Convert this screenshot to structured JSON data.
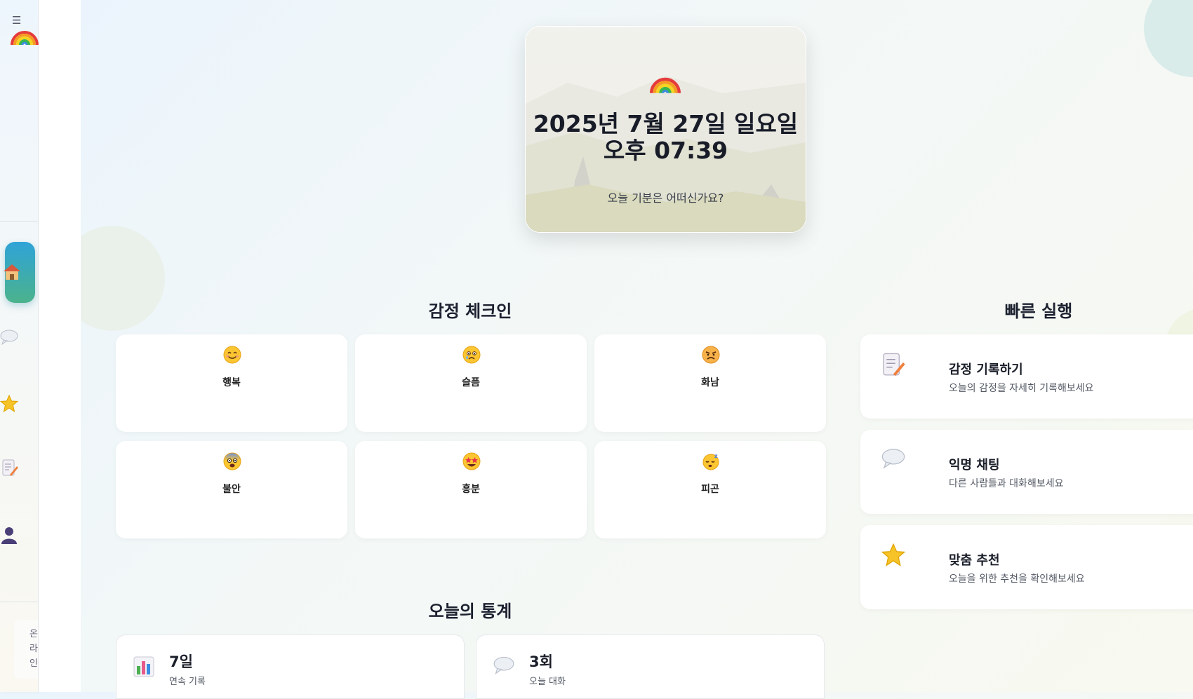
{
  "sidebar": {
    "menu_icon": "hamburger-icon",
    "logo_icon": "rainbow-icon",
    "nav": [
      {
        "icon": "home-icon",
        "active": true
      },
      {
        "icon": "chat-bubble-icon",
        "active": false
      },
      {
        "icon": "star-icon",
        "active": false
      },
      {
        "icon": "memo-icon",
        "active": false
      },
      {
        "icon": "user-silhouette-icon",
        "active": false
      }
    ],
    "status_text": "온라인"
  },
  "hero": {
    "icon": "rainbow-icon",
    "date": "2025년 7월 27일 일요일",
    "time": "오후 07:39",
    "question": "오늘 기분은 어떠신가요?"
  },
  "emotion_checkin": {
    "title": "감정 체크인",
    "items": [
      {
        "label": "행복",
        "icon": "smiling-face-icon"
      },
      {
        "label": "슬픔",
        "icon": "sad-face-icon"
      },
      {
        "label": "화남",
        "icon": "angry-face-icon"
      },
      {
        "label": "불안",
        "icon": "fearful-face-icon"
      },
      {
        "label": "흥분",
        "icon": "star-struck-face-icon"
      },
      {
        "label": "피곤",
        "icon": "sleeping-face-icon"
      }
    ]
  },
  "quick_actions": {
    "title": "빠른 실행",
    "items": [
      {
        "title": "감정 기록하기",
        "desc": "오늘의 감정을 자세히 기록해보세요",
        "icon": "memo-icon"
      },
      {
        "title": "익명 채팅",
        "desc": "다른 사람들과 대화해보세요",
        "icon": "chat-bubble-icon"
      },
      {
        "title": "맞춤 추천",
        "desc": "오늘을 위한 추천을 확인해보세요",
        "icon": "star-icon"
      }
    ]
  },
  "stats": {
    "title": "오늘의 통계",
    "items": [
      {
        "value": "7일",
        "label": "연속 기록",
        "icon": "bar-chart-icon"
      },
      {
        "value": "3회",
        "label": "오늘 대화",
        "icon": "chat-bubble-icon"
      }
    ]
  },
  "colors": {
    "active_nav_top": "#2fa3d8",
    "active_nav_bottom": "#4bb38c",
    "background": "#eef6f6"
  }
}
